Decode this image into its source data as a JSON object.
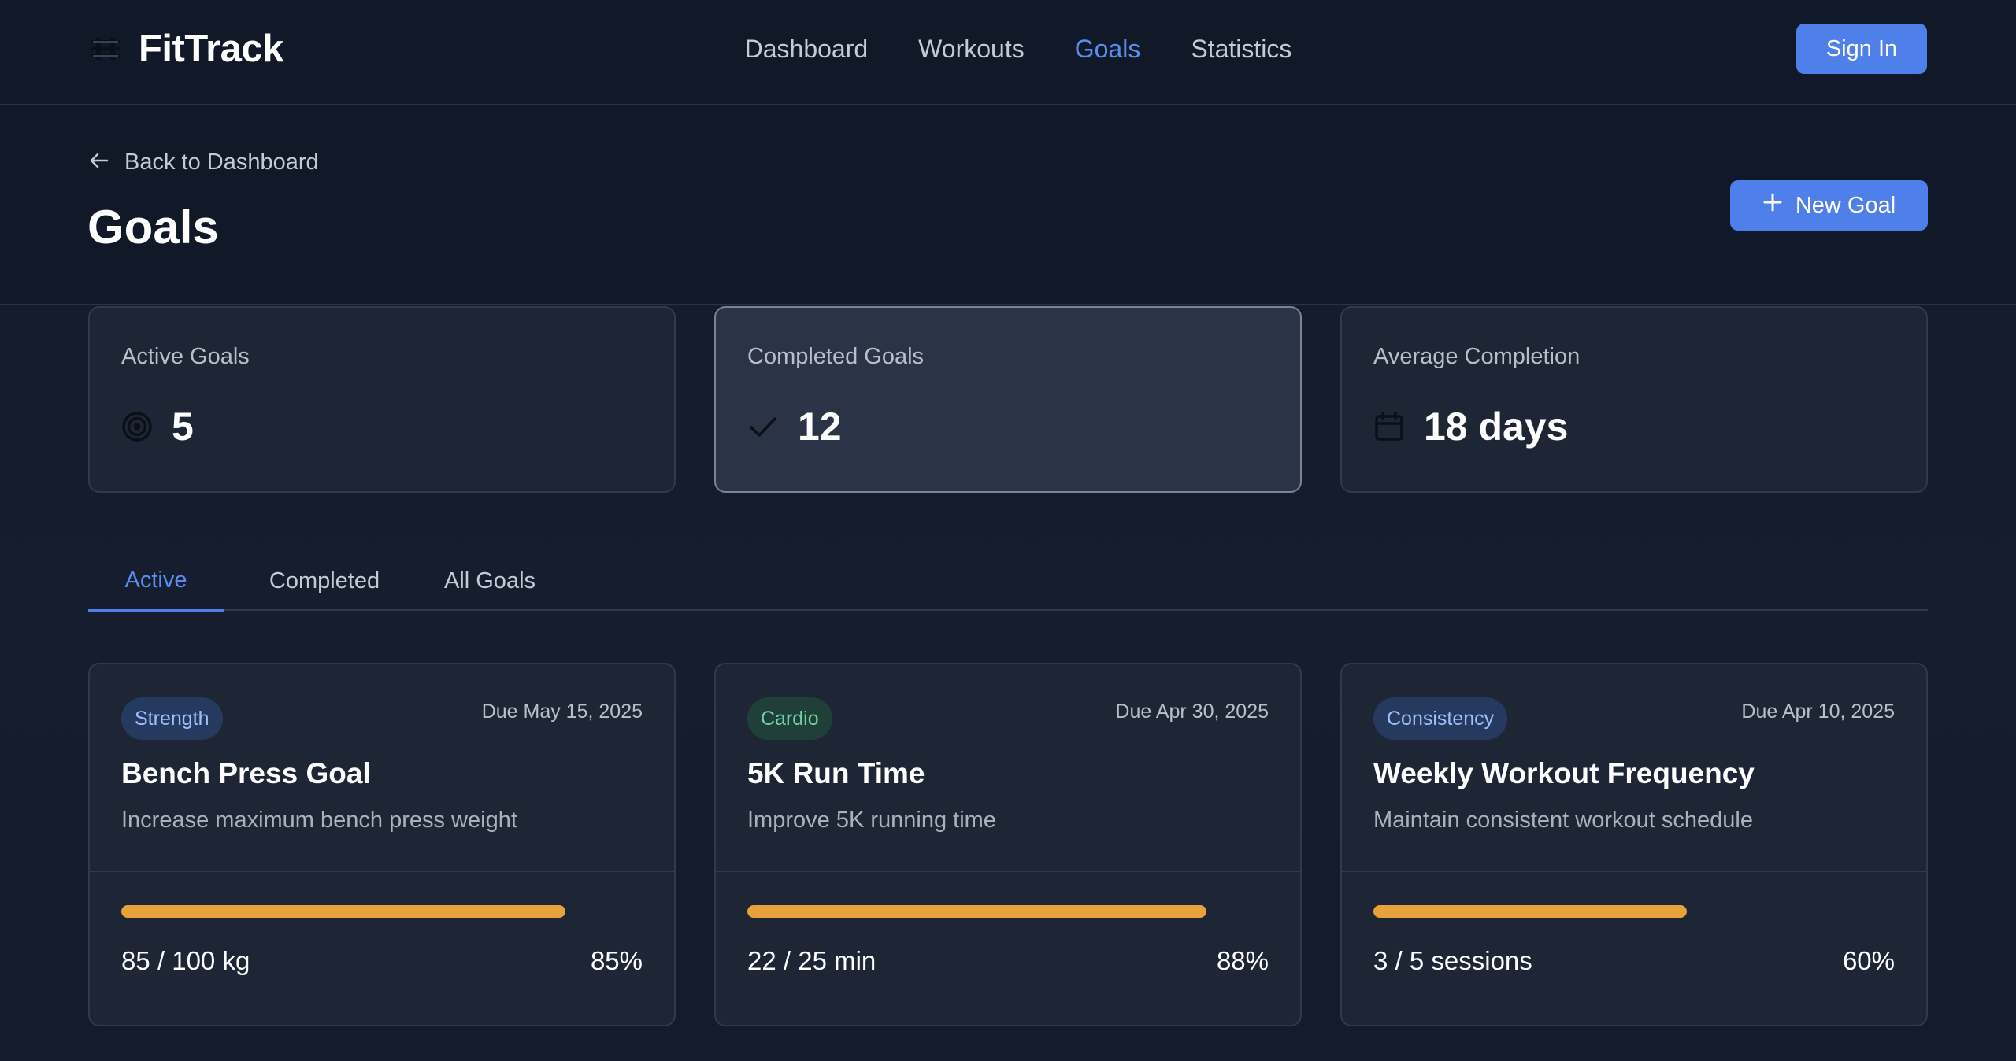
{
  "app": {
    "name": "FitTrack"
  },
  "nav": {
    "items": [
      {
        "label": "Dashboard",
        "active": false
      },
      {
        "label": "Workouts",
        "active": false
      },
      {
        "label": "Goals",
        "active": true
      },
      {
        "label": "Statistics",
        "active": false
      }
    ],
    "sign_in_label": "Sign In"
  },
  "page": {
    "back_label": "Back to Dashboard",
    "title": "Goals",
    "new_goal_label": "New Goal"
  },
  "stats": [
    {
      "label": "Active Goals",
      "value": "5",
      "icon": "target-icon"
    },
    {
      "label": "Completed Goals",
      "value": "12",
      "icon": "check-icon",
      "highlighted": true
    },
    {
      "label": "Average Completion",
      "value": "18 days",
      "icon": "calendar-icon"
    }
  ],
  "tabs": [
    {
      "label": "Active",
      "active": true
    },
    {
      "label": "Completed",
      "active": false
    },
    {
      "label": "All Goals",
      "active": false
    }
  ],
  "goals": [
    {
      "category": "Strength",
      "category_color": "#9ec0ff",
      "due": "Due May 15, 2025",
      "title": "Bench Press Goal",
      "description": "Increase maximum bench press weight",
      "amount": "85 / 100 kg",
      "percent_label": "85%",
      "progress": 0.85
    },
    {
      "category": "Cardio",
      "category_color": "#73d3a4",
      "due": "Due Apr 30, 2025",
      "title": "5K Run Time",
      "description": "Improve 5K running time",
      "amount": "22 / 25 min",
      "percent_label": "88%",
      "progress": 0.88
    },
    {
      "category": "Consistency",
      "category_color": "#9ec0ff",
      "due": "Due Apr 10, 2025",
      "title": "Weekly Workout Frequency",
      "description": "Maintain consistent workout schedule",
      "amount": "3 / 5 sessions",
      "percent_label": "60%",
      "progress": 0.6
    }
  ],
  "colors": {
    "accent": "#4f7fe8",
    "progress_bar": "#e8a23c",
    "background": "#111827"
  }
}
